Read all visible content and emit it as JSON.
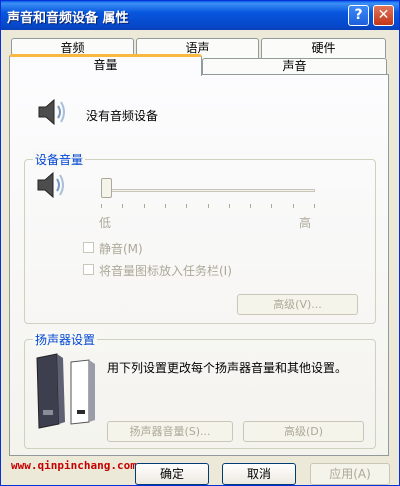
{
  "window": {
    "title": "声音和音频设备 属性"
  },
  "titlebar": {
    "help": "?",
    "close": "✕"
  },
  "tabs": {
    "row_back": [
      "音频",
      "语声",
      "硬件"
    ],
    "row_front": [
      "音量",
      "声音"
    ]
  },
  "volume_tab": {
    "status": "没有音频设备",
    "device_volume": {
      "title": "设备音量",
      "low": "低",
      "high": "高",
      "level_fraction": 0.0,
      "mute_label": "静音(M)",
      "taskbar_label": "将音量图标放入任务栏(I)",
      "advanced_label": "高级(V)..."
    },
    "speaker_settings": {
      "title": "扬声器设置",
      "description": "用下列设置更改每个扬声器音量和其他设置。",
      "speaker_volume_label": "扬声器音量(S)...",
      "advanced_label": "高级(D)"
    }
  },
  "footer": {
    "ok": "确定",
    "cancel": "取消",
    "apply": "应用(A)"
  },
  "watermark": "www.qinpinchang.com",
  "colors": {
    "titlebar": "#0756dd",
    "active_tab_accent": "#f9b941",
    "group_title": "#0046d5",
    "disabled_text": "#aca899"
  },
  "icons": {
    "speaker": "speaker-icon",
    "speakers_pair": "speakers-pair-icon"
  }
}
